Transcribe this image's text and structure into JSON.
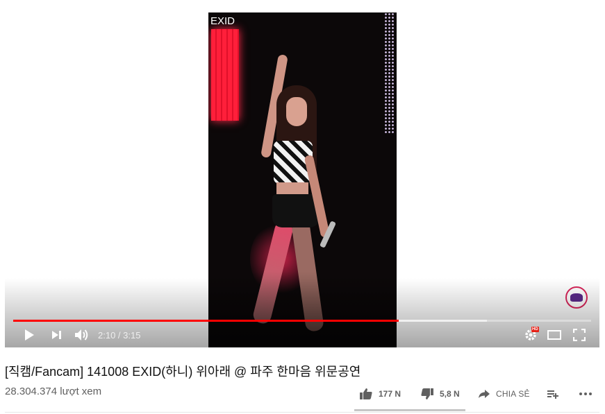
{
  "player": {
    "watermark": "EXID",
    "time": {
      "current": "2:10",
      "duration": "3:15",
      "display": "2:10 / 3:15"
    },
    "progress": {
      "played_fraction": 0.667,
      "buffered_fraction": 0.82
    },
    "hd_label": "HD",
    "colors": {
      "played": "#ff0000",
      "hd": "#e62117"
    },
    "icons": [
      "play-icon",
      "next-icon",
      "volume-icon",
      "settings-icon",
      "theater-mode-icon",
      "fullscreen-icon"
    ]
  },
  "video": {
    "title": "[직캠/Fancam] 141008 EXID(하니) 위아래 @ 파주 한마음 위문공연",
    "views": "28.304.374 lượt xem"
  },
  "actions": {
    "like_count": "177 N",
    "dislike_count": "5,8 N",
    "share_label": "CHIA SẺ",
    "icons": [
      "thumbs-up-icon",
      "thumbs-down-icon",
      "share-icon",
      "add-to-playlist-icon",
      "more-icon"
    ]
  }
}
